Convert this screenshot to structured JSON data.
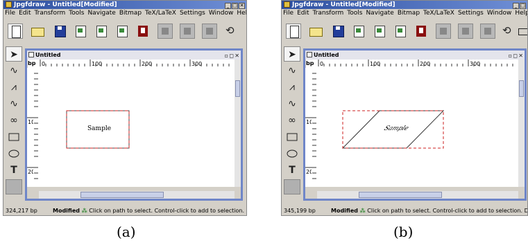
{
  "panels": [
    {
      "window_title": "Jpgfdraw - Untitled[Modified]",
      "menu": [
        "File",
        "Edit",
        "Transform",
        "Tools",
        "Navigate",
        "Bitmap",
        "TeX/LaTeX",
        "Settings",
        "Window",
        "Help"
      ],
      "inner_title": "Untitled",
      "ruler_unit": "bp",
      "ruler_labels": [
        "0",
        "100",
        "200",
        "300"
      ],
      "side_label_1": "100",
      "side_label_2": "200",
      "shape_text": "Sample",
      "status_coords": "324,217 bp",
      "status_modified": "Modified",
      "status_message": "Click on path to select. Control-click to add to selection. Doub",
      "caption": "(a)"
    },
    {
      "window_title": "Jpgfdraw - Untitled[Modified]",
      "menu": [
        "File",
        "Edit",
        "Transform",
        "Tools",
        "Navigate",
        "Bitmap",
        "TeX/LaTeX",
        "Settings",
        "Window",
        "Help"
      ],
      "inner_title": "Untitled",
      "ruler_unit": "bp",
      "ruler_labels": [
        "0",
        "100",
        "200",
        "300"
      ],
      "side_label_1": "100",
      "side_label_2": "200",
      "shape_text": "Sample",
      "status_coords": "345,199 bp",
      "status_modified": "Modified",
      "status_message": "Click on path to select. Control-click to add to selection. Dou",
      "caption": "(b)"
    }
  ],
  "icons": {
    "close": "✕",
    "minimize": "_",
    "maximize": "□",
    "pointer": "➤",
    "spline": "∿",
    "polyline": "⩘",
    "curve": "∿",
    "loop": "∞",
    "text": "T"
  },
  "colors": {
    "title_bar": "#2d4fa0",
    "inner_frame": "#6f86c8",
    "selection_dash": "#cc2222"
  }
}
